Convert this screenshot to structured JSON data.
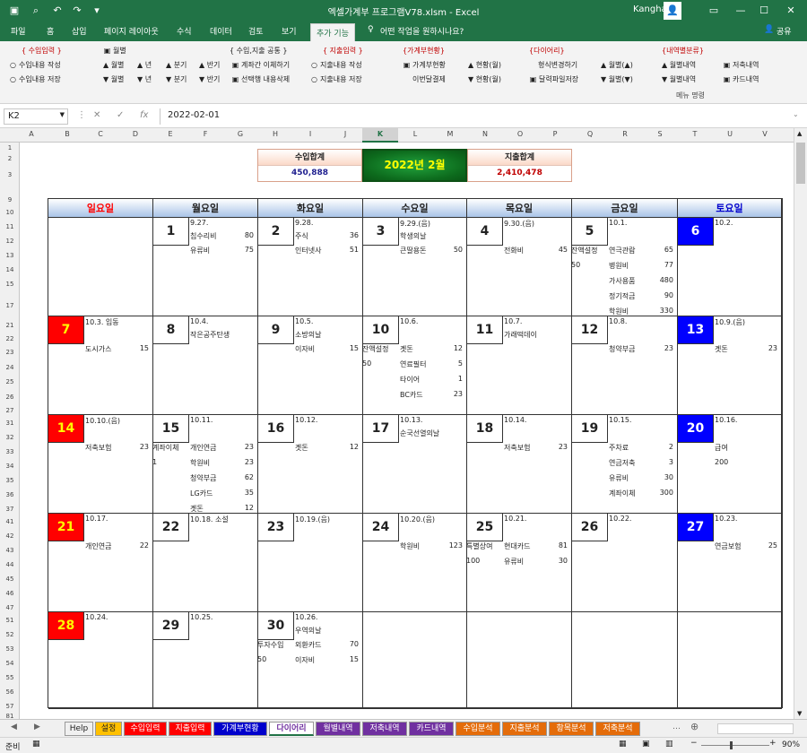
{
  "window": {
    "title": "엑셀가계부 프로그램V78.xlsm  -  Excel",
    "user": "Kangha"
  },
  "tabs": [
    "파일",
    "홈",
    "삽입",
    "페이지 레이아웃",
    "수식",
    "데이터",
    "검토",
    "보기",
    "추가 기능",
    "어떤 작업을 원하시나요?",
    "공유"
  ],
  "ribbon": [
    {
      "text": "{ 수입입력 }",
      "icon": "💡"
    },
    {
      "text": "수입내용 작성",
      "icon": "○"
    },
    {
      "text": "수입내용 저장",
      "icon": "○"
    },
    {
      "text": "월별",
      "icon": "▣"
    },
    {
      "text": "▲ 월별",
      "icon": ""
    },
    {
      "text": "▼ 월별",
      "icon": ""
    },
    {
      "text": "▲ 년",
      "icon": ""
    },
    {
      "text": "▼ 년",
      "icon": ""
    },
    {
      "text": "▲ 분기",
      "icon": ""
    },
    {
      "text": "▼ 분기",
      "icon": ""
    },
    {
      "text": "▲ 반기",
      "icon": ""
    },
    {
      "text": "▼ 반기",
      "icon": ""
    },
    {
      "text": "{ 수입,지출 공통 }",
      "icon": "💡"
    },
    {
      "text": "계좌간 이체하기",
      "icon": "▣"
    },
    {
      "text": "선택행 내용삭제",
      "icon": "▣"
    },
    {
      "text": "{ 지출입력 }",
      "icon": "💡"
    },
    {
      "text": "지출내용 작성",
      "icon": "○"
    },
    {
      "text": "지출내용 저장",
      "icon": "○"
    },
    {
      "text": "{가계부현황}",
      "icon": "💡"
    },
    {
      "text": "가계부현황",
      "icon": "▣"
    },
    {
      "text": "이번달결제",
      "icon": ""
    },
    {
      "text": "▲ 현황(월)",
      "icon": ""
    },
    {
      "text": "▼ 현황(월)",
      "icon": ""
    },
    {
      "text": "{다이어리}",
      "icon": "💡"
    },
    {
      "text": "형식변경하기",
      "icon": ""
    },
    {
      "text": "달력파일저장",
      "icon": "▣"
    },
    {
      "text": "▲ 월별(▲)",
      "icon": ""
    },
    {
      "text": "▼ 월별(▼)",
      "icon": ""
    },
    {
      "text": "{내역별분류}",
      "icon": "💡"
    },
    {
      "text": "▲ 월별내역",
      "icon": ""
    },
    {
      "text": "▼ 월별내역",
      "icon": ""
    },
    {
      "text": "저축내역",
      "icon": "▣"
    },
    {
      "text": "카드내역",
      "icon": "▣"
    }
  ],
  "ribbon_group_label": "메뉴 명령",
  "formula_bar": {
    "cell": "K2",
    "formula": "2022-02-01"
  },
  "columns": [
    "A",
    "B",
    "C",
    "D",
    "E",
    "F",
    "G",
    "H",
    "I",
    "J",
    "K",
    "L",
    "M",
    "N",
    "O",
    "P",
    "Q",
    "R",
    "S",
    "T",
    "U",
    "V"
  ],
  "rows": [
    "1",
    "2",
    "3",
    "9",
    "10",
    "11",
    "12",
    "13",
    "14",
    "15",
    "17",
    "21",
    "22",
    "23",
    "24",
    "25",
    "26",
    "27",
    "31",
    "32",
    "33",
    "34",
    "35",
    "36",
    "37",
    "41",
    "42",
    "43",
    "44",
    "45",
    "46",
    "47",
    "51",
    "52",
    "53",
    "54",
    "55",
    "56",
    "57",
    "81"
  ],
  "summary": {
    "income_label": "수입합계",
    "income_value": "450,888",
    "month": "2022년 2월",
    "expense_label": "지출합계",
    "expense_value": "2,410,478"
  },
  "weekdays": [
    "일요일",
    "월요일",
    "화요일",
    "수요일",
    "목요일",
    "금요일",
    "토요일"
  ],
  "weeks": [
    [
      {
        "n": "",
        "d": "",
        "l": []
      },
      {
        "n": "1",
        "d": "9.27.",
        "l": [
          [
            "",
            "칩수리비",
            "80"
          ],
          [
            "",
            "유류비",
            "75"
          ]
        ]
      },
      {
        "n": "2",
        "d": "9.28.",
        "l": [
          [
            "",
            "주식",
            "36"
          ],
          [
            "",
            "인터넷사",
            "51"
          ]
        ]
      },
      {
        "n": "3",
        "d": "9.29.(음)",
        "l": [
          [
            "",
            "학생의날",
            ""
          ],
          [
            "",
            "큰딸용돈",
            "50"
          ]
        ]
      },
      {
        "n": "4",
        "d": "9.30.(음)",
        "l": [
          [
            "",
            "",
            ""
          ],
          [
            "",
            "전화비",
            "45"
          ]
        ]
      },
      {
        "n": "5",
        "d": "10.1.",
        "l": [
          [
            "",
            "",
            ""
          ],
          [
            "잔액설정",
            "연극관람",
            "65"
          ],
          [
            "50",
            "병원비",
            "77"
          ],
          [
            "",
            "가사용품",
            "480"
          ],
          [
            "",
            "정기적금",
            "90"
          ],
          [
            "",
            "학원비",
            "330"
          ]
        ]
      },
      {
        "n": "6",
        "d": "10.2.",
        "l": []
      }
    ],
    [
      {
        "n": "7",
        "d": "10.3.       입동",
        "l": [
          [
            "",
            "",
            ""
          ],
          [
            "",
            "도시가스",
            "15"
          ]
        ]
      },
      {
        "n": "8",
        "d": "10.4.",
        "l": [
          [
            "",
            "작은공주탄생",
            ""
          ]
        ]
      },
      {
        "n": "9",
        "d": "10.5.",
        "l": [
          [
            "",
            "소방의날",
            ""
          ],
          [
            "",
            "이자비",
            "15"
          ]
        ]
      },
      {
        "n": "10",
        "d": "10.6.",
        "l": [
          [
            "",
            "",
            ""
          ],
          [
            "잔액설정",
            "곗돈",
            "12"
          ],
          [
            "50",
            "연료필터",
            "5"
          ],
          [
            "",
            "타이어",
            "1"
          ],
          [
            "",
            "BC카드",
            "23"
          ]
        ]
      },
      {
        "n": "11",
        "d": "10.7.",
        "l": [
          [
            "",
            "가래떡데이",
            ""
          ]
        ]
      },
      {
        "n": "12",
        "d": "10.8.",
        "l": [
          [
            "",
            "",
            ""
          ],
          [
            "",
            "청약부금",
            "23"
          ]
        ]
      },
      {
        "n": "13",
        "d": "10.9.(음)",
        "l": [
          [
            "",
            "",
            ""
          ],
          [
            "",
            "곗돈",
            "23"
          ]
        ]
      }
    ],
    [
      {
        "n": "14",
        "d": "10.10.(음)",
        "l": [
          [
            "",
            "",
            ""
          ],
          [
            "",
            "저축보험",
            "23"
          ]
        ]
      },
      {
        "n": "15",
        "d": "10.11.",
        "l": [
          [
            "",
            "",
            ""
          ],
          [
            "계좌이체",
            "개인연금",
            "23"
          ],
          [
            "1",
            "학원비",
            "23"
          ],
          [
            "",
            "청약부금",
            "62"
          ],
          [
            "",
            "LG카드",
            "35"
          ],
          [
            "",
            "곗돈",
            "12"
          ]
        ]
      },
      {
        "n": "16",
        "d": "10.12.",
        "l": [
          [
            "",
            "",
            ""
          ],
          [
            "",
            "곗돈",
            "12"
          ]
        ]
      },
      {
        "n": "17",
        "d": "10.13.",
        "l": [
          [
            "",
            "순국선열의날",
            ""
          ]
        ]
      },
      {
        "n": "18",
        "d": "10.14.",
        "l": [
          [
            "",
            "",
            ""
          ],
          [
            "",
            "저축보험",
            "23"
          ]
        ]
      },
      {
        "n": "19",
        "d": "10.15.",
        "l": [
          [
            "",
            "",
            ""
          ],
          [
            "",
            "주차료",
            "2"
          ],
          [
            "",
            "연금저축",
            "3"
          ],
          [
            "",
            "유류비",
            "30"
          ],
          [
            "",
            "계좌이체",
            "300"
          ]
        ]
      },
      {
        "n": "20",
        "d": "10.16.",
        "l": [
          [
            "",
            "",
            ""
          ],
          [
            "",
            "급여",
            ""
          ],
          [
            "",
            "200",
            ""
          ]
        ]
      }
    ],
    [
      {
        "n": "21",
        "d": "10.17.",
        "l": [
          [
            "",
            "",
            ""
          ],
          [
            "",
            "개인연금",
            "22"
          ]
        ]
      },
      {
        "n": "22",
        "d": "10.18.       소설",
        "l": []
      },
      {
        "n": "23",
        "d": "10.19.(음)",
        "l": []
      },
      {
        "n": "24",
        "d": "10.20.(음)",
        "l": [
          [
            "",
            "",
            ""
          ],
          [
            "",
            "학원비",
            "123"
          ]
        ]
      },
      {
        "n": "25",
        "d": "10.21.",
        "l": [
          [
            "",
            "",
            ""
          ],
          [
            "특별상여",
            "현대카드",
            "81"
          ],
          [
            "100",
            "유류비",
            "30"
          ]
        ]
      },
      {
        "n": "26",
        "d": "10.22.",
        "l": []
      },
      {
        "n": "27",
        "d": "10.23.",
        "l": [
          [
            "",
            "",
            ""
          ],
          [
            "",
            "연금보험",
            "25"
          ]
        ]
      }
    ],
    [
      {
        "n": "28",
        "d": "10.24.",
        "l": []
      },
      {
        "n": "29",
        "d": "10.25.",
        "l": []
      },
      {
        "n": "30",
        "d": "10.26.",
        "l": [
          [
            "",
            "우역의날",
            ""
          ],
          [
            "투자수입",
            "외환카드",
            "70"
          ],
          [
            "50",
            "이자비",
            "15"
          ]
        ]
      },
      {
        "n": "",
        "d": "",
        "l": []
      },
      {
        "n": "",
        "d": "",
        "l": []
      },
      {
        "n": "",
        "d": "",
        "l": []
      },
      {
        "n": "",
        "d": "",
        "l": []
      }
    ]
  ],
  "sheets": [
    {
      "name": "Help",
      "bg": "#f0f0f0",
      "fg": "#222"
    },
    {
      "name": "설정",
      "bg": "#ffc000",
      "fg": "#222"
    },
    {
      "name": "수입입력",
      "bg": "#ff0000",
      "fg": "#fff"
    },
    {
      "name": "지출입력",
      "bg": "#ff0000",
      "fg": "#fff"
    },
    {
      "name": "가계부현황",
      "bg": "#0000cc",
      "fg": "#fff"
    },
    {
      "name": "다이어리",
      "bg": "#ffffff",
      "fg": "#7030a0"
    },
    {
      "name": "월별내역",
      "bg": "#7030a0",
      "fg": "#fff"
    },
    {
      "name": "저축내역",
      "bg": "#7030a0",
      "fg": "#fff"
    },
    {
      "name": "카드내역",
      "bg": "#7030a0",
      "fg": "#fff"
    },
    {
      "name": "수입분석",
      "bg": "#e46c0a",
      "fg": "#fff"
    },
    {
      "name": "지출분석",
      "bg": "#e46c0a",
      "fg": "#fff"
    },
    {
      "name": "항목분석",
      "bg": "#e46c0a",
      "fg": "#fff"
    },
    {
      "name": "저축분석",
      "bg": "#e46c0a",
      "fg": "#fff"
    }
  ],
  "status": {
    "ready": "준비",
    "zoom": "90%"
  }
}
